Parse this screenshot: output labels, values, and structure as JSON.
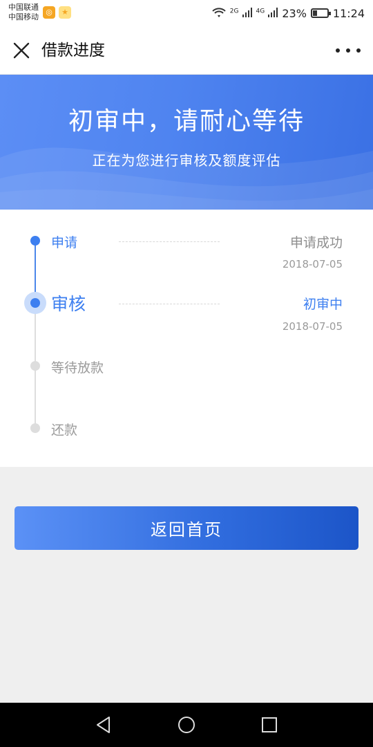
{
  "status_bar": {
    "carrier_1": "中国联通",
    "carrier_2": "中国移动",
    "network_1": "2G",
    "network_2": "4G",
    "battery": "23%",
    "time": "11:24"
  },
  "nav": {
    "title": "借款进度"
  },
  "banner": {
    "title": "初审中，请耐心等待",
    "subtitle": "正在为您进行审核及额度评估"
  },
  "progress": {
    "steps": [
      {
        "label": "申请",
        "status": "申请成功",
        "date": "2018-07-05"
      },
      {
        "label": "审核",
        "status": "初审中",
        "date": "2018-07-05"
      },
      {
        "label": "等待放款"
      },
      {
        "label": "还款"
      }
    ]
  },
  "actions": {
    "home_label": "返回首页"
  },
  "colors": {
    "accent": "#3d7ff0",
    "pending": "#dddddd"
  }
}
